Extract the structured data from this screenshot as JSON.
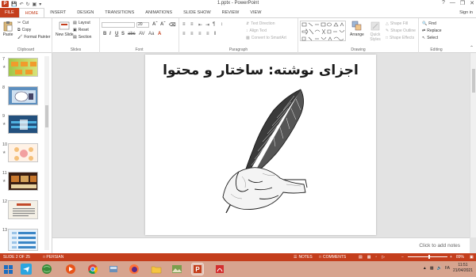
{
  "window": {
    "title": "1.pptx - PowerPoint",
    "app_logo": "P",
    "controls": [
      "?",
      "—",
      "❐",
      "✕"
    ]
  },
  "tabs": [
    "FILE",
    "HOME",
    "INSERT",
    "DESIGN",
    "TRANSITIONS",
    "ANIMATIONS",
    "SLIDE SHOW",
    "REVIEW",
    "VIEW"
  ],
  "active_tab": "HOME",
  "signin": "Sign in",
  "ribbon": {
    "clipboard": {
      "paste": "Paste",
      "cut": "Cut",
      "copy": "Copy",
      "format_painter": "Format Painter",
      "label": "Clipboard"
    },
    "slides": {
      "new_slide": "New Slide",
      "layout": "Layout",
      "reset": "Reset",
      "section": "Section",
      "label": "Slides"
    },
    "font": {
      "size": "20",
      "label": "Font",
      "buttons": [
        "B",
        "I",
        "U",
        "S",
        "abc",
        "AV",
        "Aa",
        "A"
      ]
    },
    "paragraph": {
      "text_direction": "Text Direction",
      "align_text": "Align Text",
      "convert_smartart": "Convert to SmartArt",
      "label": "Paragraph"
    },
    "drawing": {
      "arrange": "Arrange",
      "quick_styles": "Quick Styles",
      "shape_fill": "Shape Fill",
      "shape_outline": "Shape Outline",
      "shape_effects": "Shape Effects",
      "label": "Drawing"
    },
    "editing": {
      "find": "Find",
      "replace": "Replace",
      "select": "Select",
      "label": "Editing"
    }
  },
  "thumbnails": [
    {
      "num": "7",
      "star": true
    },
    {
      "num": "8",
      "star": false
    },
    {
      "num": "9",
      "star": true
    },
    {
      "num": "10",
      "star": true
    },
    {
      "num": "11",
      "star": true
    },
    {
      "num": "12",
      "star": false
    },
    {
      "num": "13",
      "star": false
    }
  ],
  "slide": {
    "title": "اجزای نوشته: ساختار و محتوا"
  },
  "notes_placeholder": "Click to add notes",
  "status": {
    "slide_of": "SLIDE 2 OF 25",
    "language": "PERSIAN",
    "notes": "NOTES",
    "comments": "COMMENTS",
    "zoom": "89%",
    "zoom_fraction": 0.55
  },
  "taskbar": {
    "time": "11:51",
    "date": "21/04/2021",
    "lang": "FA"
  },
  "colors": {
    "accent": "#c43e1c",
    "taskbar": "#d7a48f"
  }
}
